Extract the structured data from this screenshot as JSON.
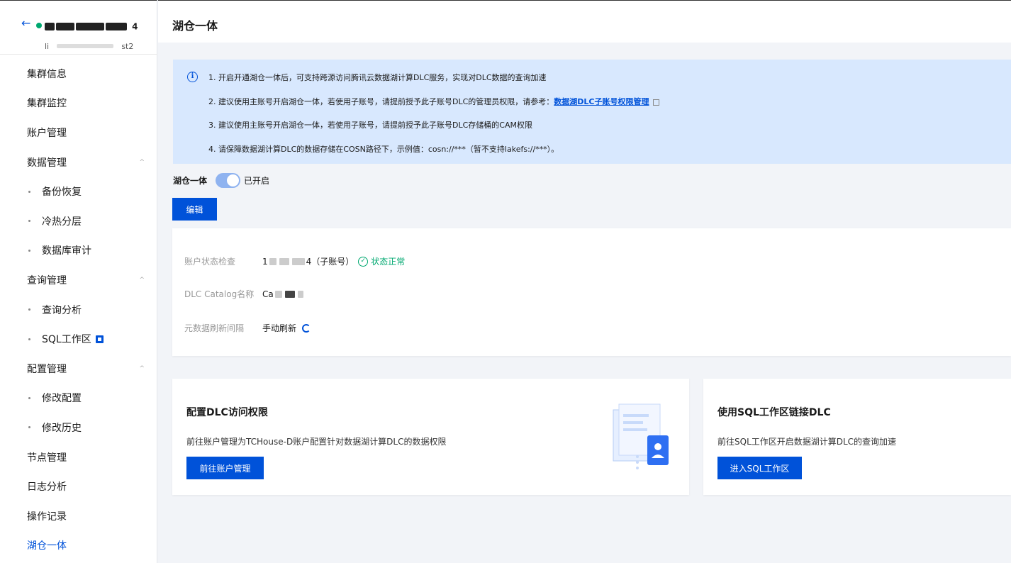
{
  "sidebar": {
    "back_icon": "arrow-left-icon",
    "cluster_name_visible": "4",
    "cluster_id_start": "li",
    "cluster_id_end": "st2",
    "items": [
      {
        "label": "集群信息",
        "type": "item"
      },
      {
        "label": "集群监控",
        "type": "item"
      },
      {
        "label": "账户管理",
        "type": "item"
      },
      {
        "label": "数据管理",
        "type": "group"
      },
      {
        "label": "备份恢复",
        "type": "sub"
      },
      {
        "label": "冷热分层",
        "type": "sub"
      },
      {
        "label": "数据库审计",
        "type": "sub"
      },
      {
        "label": "查询管理",
        "type": "group"
      },
      {
        "label": "查询分析",
        "type": "sub"
      },
      {
        "label": "SQL工作区",
        "type": "sub-ext"
      },
      {
        "label": "配置管理",
        "type": "group"
      },
      {
        "label": "修改配置",
        "type": "sub"
      },
      {
        "label": "修改历史",
        "type": "sub"
      },
      {
        "label": "节点管理",
        "type": "item"
      },
      {
        "label": "日志分析",
        "type": "item"
      },
      {
        "label": "操作记录",
        "type": "item"
      },
      {
        "label": "湖仓一体",
        "type": "active"
      }
    ]
  },
  "header": {
    "title": "湖仓一体"
  },
  "notice": {
    "line1": "1. 开启开通湖仓一体后，可支持跨源访问腾讯云数据湖计算DLC服务，实现对DLC数据的查询加速",
    "line2_prefix": "2. 建议使用主账号开启湖仓一体，若使用子账号，请提前授予此子账号DLC的管理员权限，请参考：",
    "line2_link": "数据湖DLC子账号权限管理",
    "line3": "3. 建议使用主账号开启湖仓一体，若使用子账号，请提前授予此子账号DLC存储桶的CAM权限",
    "line4": "4. 请保障数据湖计算DLC的数据存储在COSN路径下，示例值：cosn://***（暂不支持lakefs://***）。"
  },
  "toggle": {
    "label": "湖仓一体",
    "status": "已开启",
    "on": true
  },
  "edit_button": "编辑",
  "info": {
    "account_label": "账户状态检查",
    "account_prefix": "1",
    "account_suffix": "4",
    "account_type": "（子账号）",
    "account_status": "状态正常",
    "catalog_label": "DLC Catalog名称",
    "catalog_prefix": "Ca",
    "refresh_label": "元数据刷新间隔",
    "refresh_value": "手动刷新"
  },
  "cards": [
    {
      "title": "配置DLC访问权限",
      "desc": "前往账户管理为TCHouse-D账户配置针对数据湖计算DLC的数据权限",
      "button": "前往账户管理"
    },
    {
      "title": "使用SQL工作区链接DLC",
      "desc": "前往SQL工作区开启数据湖计算DLC的查询加速",
      "button": "进入SQL工作区"
    }
  ],
  "colors": {
    "primary": "#0052d9",
    "success": "#00a870",
    "notice_bg": "#d8e8fe"
  }
}
